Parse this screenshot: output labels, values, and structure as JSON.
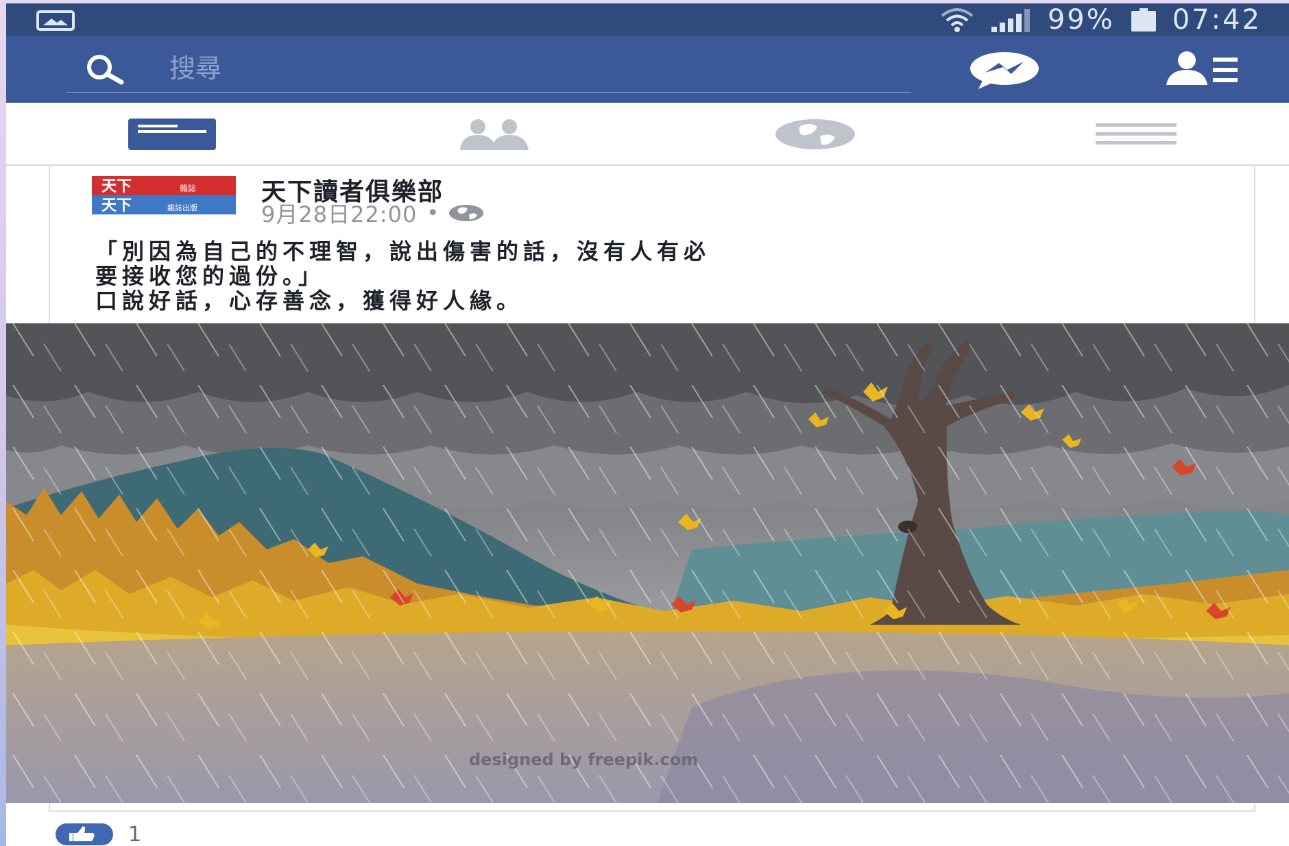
{
  "status_bar": {
    "battery_percent": "99%",
    "time": "07:42",
    "icons": [
      "gallery-icon",
      "wifi-icon",
      "signal-icon",
      "battery-icon"
    ]
  },
  "app_bar": {
    "search_placeholder": "搜尋",
    "icons": [
      "search-icon",
      "messenger-icon",
      "friend-requests-icon"
    ]
  },
  "tabs": [
    {
      "name": "news-feed",
      "icon": "news-feed-icon",
      "active": true
    },
    {
      "name": "friends",
      "icon": "friends-icon",
      "active": false
    },
    {
      "name": "notifications",
      "icon": "globe-icon",
      "active": false
    },
    {
      "name": "menu",
      "icon": "menu-icon",
      "active": false
    }
  ],
  "post": {
    "page_name": "天下讀者俱樂部",
    "avatar_text_top": "天下",
    "avatar_text_top_small": "雜誌",
    "avatar_text_bottom": "天下",
    "avatar_text_bottom_small": "雜誌出版",
    "time": "9月28日22:00",
    "dot": "•",
    "privacy_icon": "globe-icon",
    "text_lines": [
      "「別因為自己的不理智，說出傷害的話，沒有人有必",
      "要接收您的過份。」",
      "口說好話，心存善念，獲得好人緣。"
    ],
    "image_credit": "designed by  freepik.com",
    "reactions": {
      "icon": "like-icon",
      "count": "1"
    }
  },
  "colors": {
    "status_bar": "#2f4a7c",
    "app_bar": "#3b5998",
    "active_tab": "#3b5998",
    "inactive_tab": "#bfc3ca",
    "like_blue": "#4267b2"
  }
}
